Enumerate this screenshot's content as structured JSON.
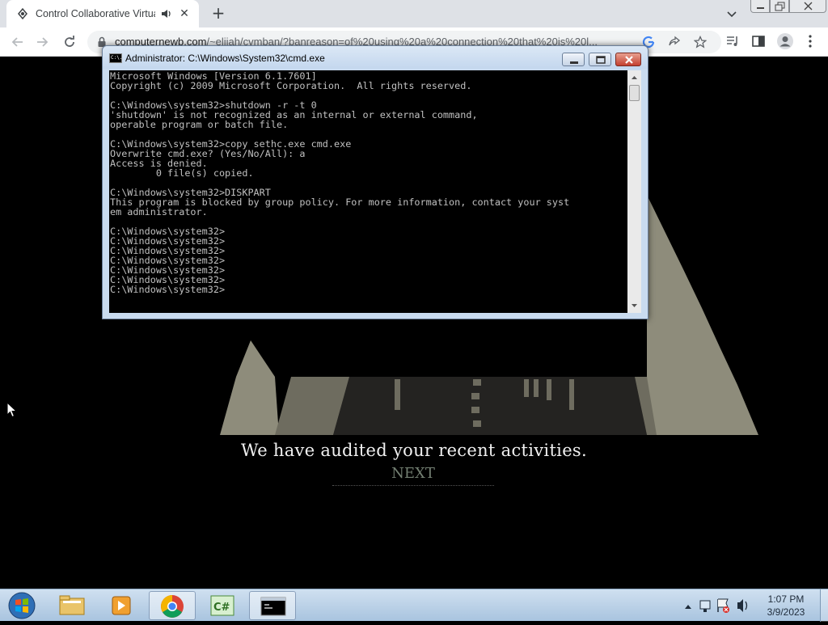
{
  "browser": {
    "tab_title": "Control Collaborative Virtual",
    "newtab_label": "+",
    "url_host": "computernewb.com",
    "url_path": "/~elijah/cvmban/?banreason=of%20using%20a%20connection%20that%20is%20l..."
  },
  "page": {
    "headline": "We have audited your recent activities.",
    "next_label": "NEXT"
  },
  "cmd": {
    "title": "Administrator: C:\\Windows\\System32\\cmd.exe",
    "icon_text": "C:\\.",
    "lines": [
      "Microsoft Windows [Version 6.1.7601]",
      "Copyright (c) 2009 Microsoft Corporation.  All rights reserved.",
      "",
      "C:\\Windows\\system32>shutdown -r -t 0",
      "'shutdown' is not recognized as an internal or external command,",
      "operable program or batch file.",
      "",
      "C:\\Windows\\system32>copy sethc.exe cmd.exe",
      "Overwrite cmd.exe? (Yes/No/All): a",
      "Access is denied.",
      "        0 file(s) copied.",
      "",
      "C:\\Windows\\system32>DISKPART",
      "This program is blocked by group policy. For more information, contact your syst",
      "em administrator.",
      "",
      "C:\\Windows\\system32>",
      "C:\\Windows\\system32>",
      "C:\\Windows\\system32>",
      "C:\\Windows\\system32>",
      "C:\\Windows\\system32>",
      "C:\\Windows\\system32>",
      "C:\\Windows\\system32>"
    ]
  },
  "taskbar": {
    "apps": [
      "windows-explorer",
      "media-player",
      "chrome",
      "csharp-ide",
      "command-prompt"
    ],
    "active_app": "command-prompt",
    "time": "1:07 PM",
    "date": "3/9/2023"
  },
  "colors": {
    "road_gray": "#8e8c7b",
    "next_text": "#737f72",
    "taskbar_top": "#cfe0f0"
  }
}
